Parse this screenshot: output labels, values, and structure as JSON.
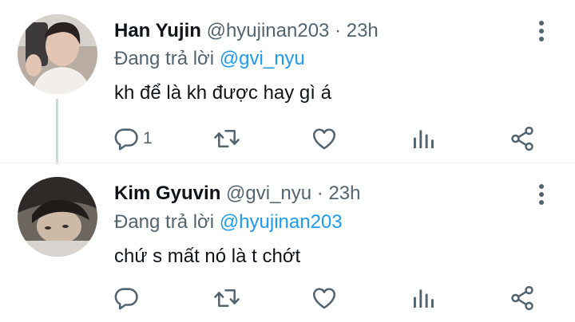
{
  "tweets": [
    {
      "name": "Han Yujin",
      "handle": "@hyujinan203",
      "time_sep": " · ",
      "time": "23h",
      "reply_prefix": "Đang trả lời ",
      "reply_to": "@gvi_nyu",
      "text": "kh để là kh được hay gì á",
      "reply_count": "1",
      "avatar_icon": "avatar-photo"
    },
    {
      "name": "Kim Gyuvin",
      "handle": "@gvi_nyu",
      "time_sep": " · ",
      "time": "23h",
      "reply_prefix": "Đang trả lời ",
      "reply_to": "@hyujinan203",
      "text": "chứ s mất nó là t chớt",
      "reply_count": "",
      "avatar_icon": "avatar-photo"
    }
  ],
  "colors": {
    "text": "#0f1419",
    "secondary": "#536471",
    "accent": "#1d9bf0",
    "thread_line": "#cfd9de"
  },
  "icons": [
    "reply-icon",
    "retweet-icon",
    "like-icon",
    "views-icon",
    "share-icon",
    "more-icon"
  ]
}
